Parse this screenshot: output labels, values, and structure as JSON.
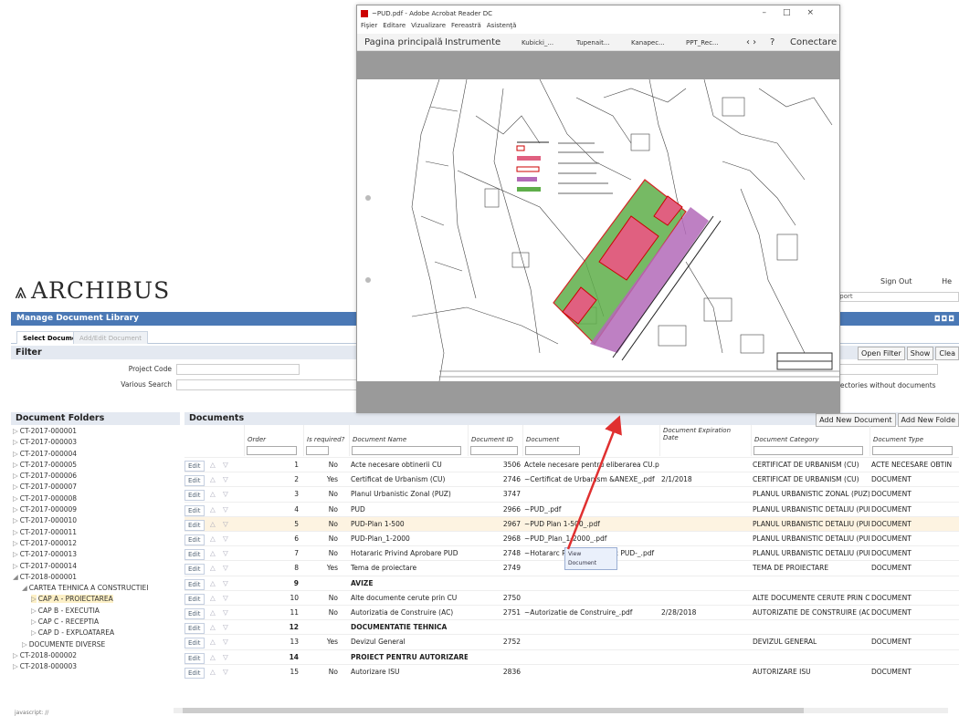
{
  "app": {
    "logo": "ARCHIBUS",
    "sign_out": "Sign Out",
    "help": "He",
    "report_text": "eport",
    "title": "Manage Document Library",
    "title_icons": "◘◘◘",
    "tabs": [
      "Select Document",
      "Add/Edit Document"
    ],
    "filter_title": "Filter",
    "filter_buttons": [
      "Open Filter",
      "Show",
      "Clea"
    ],
    "filter_fields": [
      {
        "label": "Project Code"
      },
      {
        "label": "Various Search"
      }
    ],
    "directories_text": "rectories without documents",
    "folders_title": "Document Folders",
    "documents_title": "Documents",
    "doc_buttons": [
      "Add New Document",
      "Add New Folde"
    ],
    "javascript_status": "javascript: //"
  },
  "tree": [
    {
      "label": "CT-2017-000001",
      "indent": 0,
      "icon": "▷"
    },
    {
      "label": "CT-2017-000003",
      "indent": 0,
      "icon": "▷"
    },
    {
      "label": "CT-2017-000004",
      "indent": 0,
      "icon": "▷"
    },
    {
      "label": "CT-2017-000005",
      "indent": 0,
      "icon": "▷"
    },
    {
      "label": "CT-2017-000006",
      "indent": 0,
      "icon": "▷"
    },
    {
      "label": "CT-2017-000007",
      "indent": 0,
      "icon": "▷"
    },
    {
      "label": "CT-2017-000008",
      "indent": 0,
      "icon": "▷"
    },
    {
      "label": "CT-2017-000009",
      "indent": 0,
      "icon": "▷"
    },
    {
      "label": "CT-2017-000010",
      "indent": 0,
      "icon": "▷"
    },
    {
      "label": "CT-2017-000011",
      "indent": 0,
      "icon": "▷"
    },
    {
      "label": "CT-2017-000012",
      "indent": 0,
      "icon": "▷"
    },
    {
      "label": "CT-2017-000013",
      "indent": 0,
      "icon": "▷"
    },
    {
      "label": "CT-2017-000014",
      "indent": 0,
      "icon": "▷"
    },
    {
      "label": "CT-2018-000001",
      "indent": 0,
      "icon": "◢"
    },
    {
      "label": "CARTEA TEHNICA A CONSTRUCTIEI",
      "indent": 1,
      "icon": "◢"
    },
    {
      "label": "CAP A - PROIECTAREA",
      "indent": 2,
      "icon": "▷",
      "selected": true
    },
    {
      "label": "CAP B - EXECUTIA",
      "indent": 2,
      "icon": "▷"
    },
    {
      "label": "CAP C - RECEPTIA",
      "indent": 2,
      "icon": "▷"
    },
    {
      "label": "CAP D - EXPLOATAREA",
      "indent": 2,
      "icon": "▷"
    },
    {
      "label": "DOCUMENTE DIVERSE",
      "indent": 1,
      "icon": "▷"
    },
    {
      "label": "CT-2018-000002",
      "indent": 0,
      "icon": "▷"
    },
    {
      "label": "CT-2018-000003",
      "indent": 0,
      "icon": "▷"
    }
  ],
  "columns": {
    "order": "Order",
    "required": "Is required?",
    "name": "Document Name",
    "docid": "Document ID",
    "document": "Document",
    "expdate": "Document Expiration Date",
    "category": "Document Category",
    "type": "Document Type"
  },
  "rows": [
    {
      "edit": "Edit",
      "order": "1",
      "req": "No",
      "name": "Acte necesare obtinerii CU",
      "id": "3506",
      "doc": "Actele necesare pentru eliberarea CU.pdf",
      "date": "",
      "cat": "CERTIFICAT DE URBANISM (CU)",
      "type": "ACTE NECESARE OBTIN"
    },
    {
      "edit": "Edit",
      "order": "2",
      "req": "Yes",
      "name": "Certificat de Urbanism (CU)",
      "id": "2746",
      "doc": "~Certificat de Urbanism &ANEXE_.pdf",
      "date": "2/1/2018",
      "cat": "CERTIFICAT DE URBANISM (CU)",
      "type": "DOCUMENT"
    },
    {
      "edit": "Edit",
      "order": "3",
      "req": "No",
      "name": "Planul Urbanistic Zonal (PUZ)",
      "id": "3747",
      "doc": "",
      "date": "",
      "cat": "PLANUL URBANISTIC ZONAL (PUZ)",
      "type": "DOCUMENT"
    },
    {
      "edit": "Edit",
      "order": "4",
      "req": "No",
      "name": "PUD",
      "id": "2966",
      "doc": "~PUD_.pdf",
      "date": "",
      "cat": "PLANUL URBANISTIC DETALIU (PUD)",
      "type": "DOCUMENT"
    },
    {
      "edit": "Edit",
      "order": "5",
      "req": "No",
      "name": "PUD-Plan 1-500",
      "id": "2967",
      "doc": "~PUD Plan 1-500_.pdf",
      "date": "",
      "cat": "PLANUL URBANISTIC DETALIU (PUD)",
      "type": "DOCUMENT",
      "hl": true
    },
    {
      "edit": "Edit",
      "order": "6",
      "req": "No",
      "name": "PUD-Plan_1-2000",
      "id": "2968",
      "doc": "~PUD_Plan_1-2000_.pdf",
      "date": "",
      "cat": "PLANUL URBANISTIC DETALIU (PUD)",
      "type": "DOCUMENT"
    },
    {
      "edit": "Edit",
      "order": "7",
      "req": "No",
      "name": "Hotararic Privind Aprobare PUD",
      "id": "2748",
      "doc": "~Hotararc Privind Aprobarc PUD-_.pdf",
      "date": "",
      "cat": "PLANUL URBANISTIC DETALIU (PUD)",
      "type": "DOCUMENT"
    },
    {
      "edit": "Edit",
      "order": "8",
      "req": "Yes",
      "name": "Tema de proiectare",
      "id": "2749",
      "doc": "",
      "date": "",
      "cat": "TEMA DE PROIECTARE",
      "type": "DOCUMENT"
    },
    {
      "edit": "Edit",
      "order": "9",
      "req": "",
      "name": "AVIZE",
      "id": "",
      "doc": "",
      "date": "",
      "cat": "",
      "type": "",
      "bold": true
    },
    {
      "edit": "Edit",
      "order": "10",
      "req": "No",
      "name": "Alte documente cerute prin CU",
      "id": "2750",
      "doc": "",
      "date": "",
      "cat": "ALTE DOCUMENTE CERUTE PRIN CU",
      "type": "DOCUMENT"
    },
    {
      "edit": "Edit",
      "order": "11",
      "req": "No",
      "name": "Autorizatia de Construire (AC)",
      "id": "2751",
      "doc": "~Autorizatie de Construire_.pdf",
      "date": "2/28/2018",
      "cat": "AUTORIZATIE DE CONSTRUIRE (AC)",
      "type": "DOCUMENT"
    },
    {
      "edit": "Edit",
      "order": "12",
      "req": "",
      "name": "DOCUMENTATIE TEHNICA",
      "id": "",
      "doc": "",
      "date": "",
      "cat": "",
      "type": "",
      "bold": true
    },
    {
      "edit": "Edit",
      "order": "13",
      "req": "Yes",
      "name": "Devizul General",
      "id": "2752",
      "doc": "",
      "date": "",
      "cat": "DEVIZUL GENERAL",
      "type": "DOCUMENT"
    },
    {
      "edit": "Edit",
      "order": "14",
      "req": "",
      "name": "PROIECT PENTRU AUTORIZARE ISU",
      "id": "",
      "doc": "",
      "date": "",
      "cat": "",
      "type": "",
      "bold": true
    },
    {
      "edit": "Edit",
      "order": "15",
      "req": "No",
      "name": "Autorizare ISU",
      "id": "2836",
      "doc": "",
      "date": "",
      "cat": "AUTORIZARE ISU",
      "type": "DOCUMENT"
    }
  ],
  "tooltip": {
    "line1": "View",
    "line2": "Document"
  },
  "pdf": {
    "title": "~PUD.pdf - Adobe Acrobat Reader DC",
    "window_controls": "–□×",
    "menu": [
      "Fişier",
      "Editare",
      "Vizualizare",
      "Fereastră",
      "Asistenţă"
    ],
    "toolbar": [
      "Pagina principală",
      "Instrumente",
      "Kubicki_...",
      "Tupenait...",
      "Kanapec...",
      "PPT_Rec...",
      "‹  ›",
      "?",
      "Conectare"
    ]
  },
  "colors": {
    "header_blue": "#4a78b5",
    "arrow_red": "#e03030",
    "highlight_row": "#fdf3e1"
  }
}
